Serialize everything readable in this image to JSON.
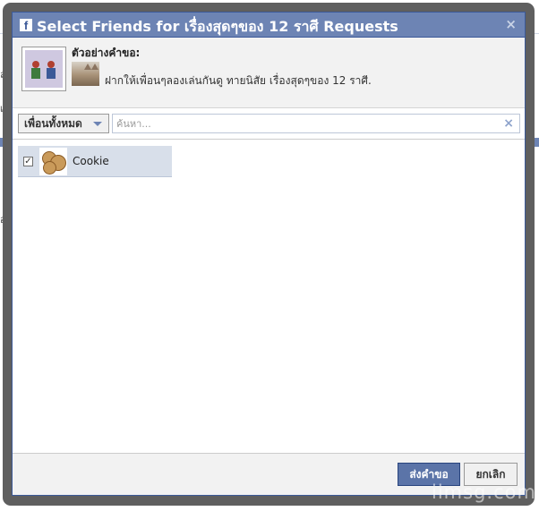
{
  "dialog": {
    "title": "Select Friends for เรื่องสุดๆของ 12 ราศี Requests",
    "close_label": "×"
  },
  "preview": {
    "label": "ตัวอย่างคำขอ:",
    "message": "ฝากให้เพื่อนๆลองเล่นกันดู ทายนิสัย เรื่องสุดๆของ 12 ราศี."
  },
  "filter": {
    "dropdown_label": "เพื่อนทั้งหมด",
    "search_placeholder": "ค้นหา...",
    "clear_label": "×"
  },
  "friends": [
    {
      "name": "Cookie",
      "checked": true,
      "check_mark": "✓"
    }
  ],
  "footer": {
    "send_label": "ส่งคำขอ",
    "cancel_label": "ยกเลิก"
  },
  "background": {
    "frag1": "ล์",
    "frag2": "เ",
    "frag3": "อง"
  },
  "watermark": "iimsg.com",
  "colors": {
    "title_bar": "#6d84b4",
    "primary_button": "#5b74a8",
    "selected_row": "#d8dfea"
  }
}
